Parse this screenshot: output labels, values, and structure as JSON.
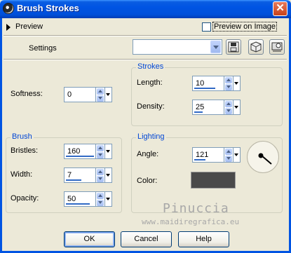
{
  "window": {
    "title": "Brush Strokes",
    "close_label": "✕"
  },
  "preview": {
    "label": "Preview",
    "checkbox_label": "Preview on Image",
    "checked": false
  },
  "settings": {
    "label": "Settings",
    "selected": ""
  },
  "toolbar": {
    "save_icon": "save-icon",
    "reset_icon": "reset-icon",
    "randomize_icon": "randomize-icon"
  },
  "softness": {
    "label": "Softness:",
    "value": "0"
  },
  "strokes": {
    "title": "Strokes",
    "length": {
      "label": "Length:",
      "value": "10"
    },
    "density": {
      "label": "Density:",
      "value": "25"
    }
  },
  "brush": {
    "title": "Brush",
    "bristles": {
      "label": "Bristles:",
      "value": "160"
    },
    "width": {
      "label": "Width:",
      "value": "7"
    },
    "opacity": {
      "label": "Opacity:",
      "value": "50"
    }
  },
  "lighting": {
    "title": "Lighting",
    "angle": {
      "label": "Angle:",
      "value": "121"
    },
    "color": {
      "label": "Color:",
      "hex": "#4a4a4a"
    }
  },
  "watermark": {
    "line1": "Pinuccia",
    "line2": "www.maidiregrafica.eu"
  },
  "buttons": {
    "ok": "OK",
    "cancel": "Cancel",
    "help": "Help"
  },
  "colors": {
    "accent": "#0054e3",
    "group_title": "#0046d5",
    "face": "#ece9d8"
  }
}
